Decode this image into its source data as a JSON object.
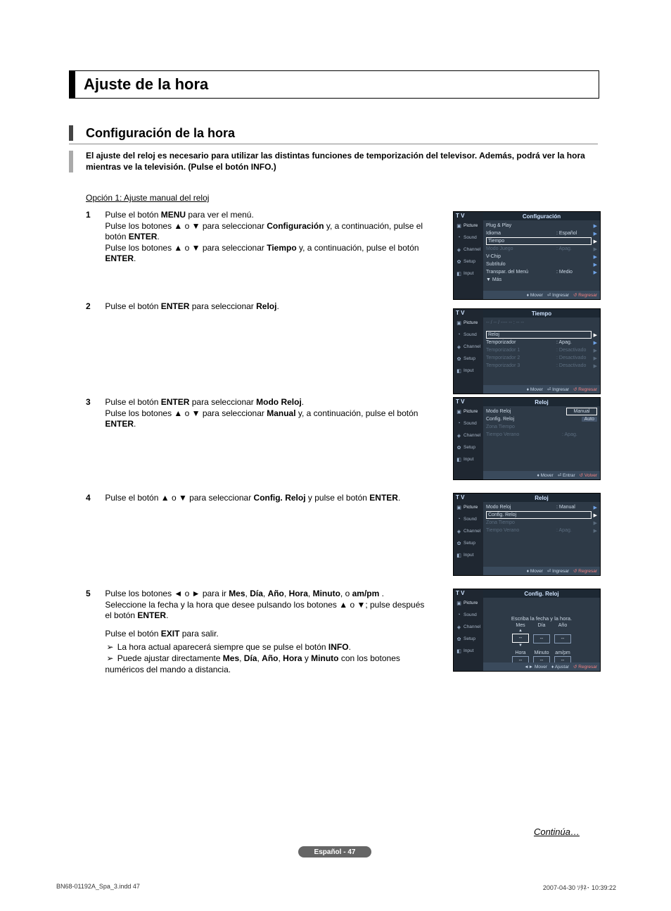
{
  "header": {
    "title": "Ajuste de la hora"
  },
  "section": {
    "title": "Configuración de la hora"
  },
  "lead": "El ajuste del reloj es necesario para utilizar las distintas funciones de temporización del televisor. Además, podrá ver la hora mientras ve la televisión. (Pulse el botón INFO.)",
  "option": "Opción 1: Ajuste manual del reloj",
  "steps": {
    "s1": {
      "num": "1",
      "l1a": "Pulse el botón ",
      "l1b": "MENU",
      "l1c": " para ver el menú.",
      "l2a": "Pulse los botones ▲ o ▼ para seleccionar ",
      "l2b": "Configuración",
      "l2c": " y, a continuación, pulse el botón ",
      "l2d": "ENTER",
      "l2e": ".",
      "l3a": "Pulse los botones ▲ o ▼ para seleccionar ",
      "l3b": "Tiempo",
      "l3c": " y, a continuación, pulse el botón ",
      "l3d": "ENTER",
      "l3e": "."
    },
    "s2": {
      "num": "2",
      "a": "Pulse el botón ",
      "b": "ENTER",
      "c": " para seleccionar ",
      "d": "Reloj",
      "e": "."
    },
    "s3": {
      "num": "3",
      "l1a": "Pulse el botón ",
      "l1b": "ENTER",
      "l1c": " para seleccionar ",
      "l1d": "Modo Reloj",
      "l1e": ".",
      "l2a": "Pulse los botones ▲ o ▼ para seleccionar ",
      "l2b": "Manual",
      "l2c": " y, a continuación, pulse el botón ",
      "l2d": "ENTER",
      "l2e": "."
    },
    "s4": {
      "num": "4",
      "a": "Pulse el botón ▲ o ▼ para seleccionar ",
      "b": "Config. Reloj",
      "c": " y pulse el botón ",
      "d": "ENTER",
      "e": "."
    },
    "s5": {
      "num": "5",
      "l1a": "Pulse los botones ◄ o ► para ir ",
      "l1b": "Mes",
      "l1c": ", ",
      "l1d": "Día",
      "l1e": ", ",
      "l1f": "Año",
      "l1g": ", ",
      "l1h": "Hora",
      "l1i": ", ",
      "l1j": "Minuto",
      "l1k": ", o ",
      "l1l": "am/pm",
      "l1m": " .",
      "l2a": "Seleccione la fecha y la hora que desee pulsando los botones ▲ o ▼; pulse después el botón ",
      "l2b": "ENTER",
      "l2c": ".",
      "exit_a": "Pulse el botón ",
      "exit_b": "EXIT",
      "exit_c": " para salir.",
      "n1a": "La hora actual aparecerá siempre que se pulse el botón ",
      "n1b": "INFO",
      "n1c": ".",
      "n2a": "Puede ajustar directamente ",
      "n2b": "Mes",
      "n2c": ", ",
      "n2d": "Día",
      "n2e": ", ",
      "n2f": "Año",
      "n2g": ", ",
      "n2h": "Hora",
      "n2i": " y ",
      "n2j": "Minuto",
      "n2k": " con los botones numéricos del mando a distancia."
    }
  },
  "arrow": "➢",
  "osd_common": {
    "tv": "T V",
    "side": {
      "picture": "Picture",
      "sound": "Sound",
      "channel": "Channel",
      "setup": "Setup",
      "input": "Input"
    },
    "mover": "Mover",
    "ingresar": "Ingresar",
    "regresar": "Regresar",
    "entrar": "Entrar",
    "volver": "Volver",
    "ajustar": "Ajustar"
  },
  "osd1": {
    "title": "Configuración",
    "rows": {
      "pp": "Plug & Play",
      "idioma": "Idioma",
      "idioma_v": ": Español",
      "tiempo": "Tiempo",
      "juego": "Modo Juego",
      "juego_v": ": Apag.",
      "vchip": "V-Chip",
      "sub": "Subtítulo",
      "trans": "Transpar. del Menú",
      "trans_v": ": Medio",
      "mas": "▼ Más"
    }
  },
  "osd2": {
    "title": "Tiempo",
    "placeholder": "-- / -- / ----    -- : --  --",
    "rows": {
      "reloj": "Reloj",
      "temp": "Temporizador",
      "temp_v": ": Apag.",
      "t1": "Temporizador 1",
      "t1v": ": Desactivado",
      "t2": "Temporizador 2",
      "t2v": ": Desactivado",
      "t3": "Temporizador 3",
      "t3v": ": Desactivado"
    }
  },
  "osd3": {
    "title": "Reloj",
    "rows": {
      "modo": "Modo Reloj",
      "modo_v_manual": "Manual",
      "modo_v_auto": "Auto",
      "conf": "Config. Reloj",
      "zona": "Zona Tiempo",
      "verano": "Tiempo Verano",
      "verano_v": ": Apag."
    }
  },
  "osd4": {
    "title": "Reloj",
    "rows": {
      "modo": "Modo Reloj",
      "modo_v": ": Manual",
      "conf": "Config. Reloj",
      "zona": "Zona Tiempo",
      "verano": "Tiempo Verano",
      "verano_v": ": Apag."
    }
  },
  "osd5": {
    "title": "Config. Reloj",
    "prompt": "Escriba la fecha y la hora.",
    "cols": {
      "mes": "Mes",
      "dia": "Día",
      "ano": "Año",
      "hora": "Hora",
      "minuto": "Minuto",
      "ampm": "am/pm"
    },
    "dash": "--"
  },
  "continua": "Continúa…",
  "pagepill": "Español - 47",
  "footer": {
    "left": "BN68-01192A_Spa_3.indd   47",
    "right": "2007-04-30   ｿﾀﾈ･ 10:39:22"
  }
}
